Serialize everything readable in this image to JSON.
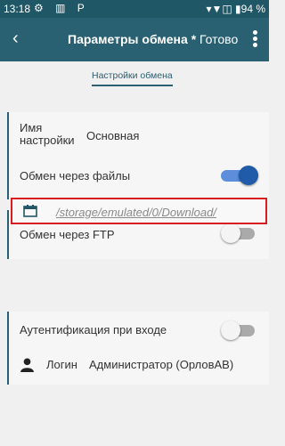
{
  "status_bar": {
    "time": "13:18",
    "left_icons": "⚙ ▥ P",
    "right": "▾▼◫ ▮94 %"
  },
  "app_bar": {
    "back_icon": "arrow-left",
    "title": "Параметры обмена *",
    "done_label": "Готово",
    "menu_icon": "more-vertical"
  },
  "tab": {
    "label": "Настройки обмена"
  },
  "settings": {
    "name_label": "Имя\nнастройки",
    "name_value": "Основная",
    "file_exchange_label": "Обмен через файлы",
    "file_exchange_enabled": true,
    "folder_path": "/storage/emulated/0/Download/",
    "ftp_label": "Обмен через FTP",
    "ftp_enabled": false,
    "auth_label": "Аутентификация при входе",
    "auth_enabled": false,
    "login_label": "Логин",
    "login_value": "Администратор (ОрловАВ)"
  },
  "colors": {
    "app_bar": "#2a6172",
    "status_bar": "#1f5767",
    "toggle_on": "#1f5ba8",
    "highlight_border": "#d81e1e"
  }
}
